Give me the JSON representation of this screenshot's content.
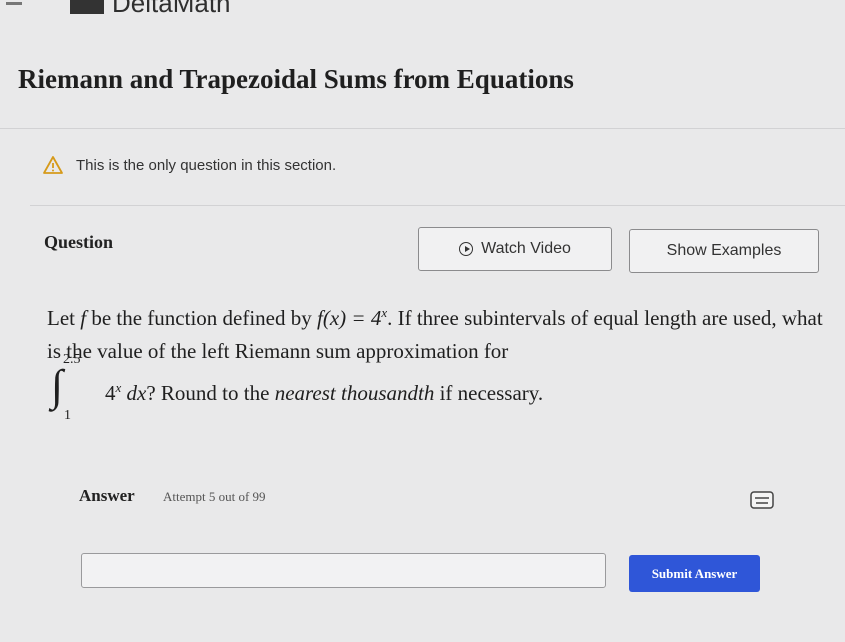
{
  "brand": {
    "name": "DeltaMath"
  },
  "page": {
    "title": "Riemann and Trapezoidal Sums from Equations"
  },
  "notice": {
    "text": "This is the only question in this section.",
    "icon": "warning-triangle-icon"
  },
  "question": {
    "label": "Question",
    "buttons": {
      "watch_video": "Watch Video",
      "show_examples": "Show Examples"
    },
    "line1_prefix": "Let ",
    "line1_f": "f",
    "line1_mid": " be the function defined by ",
    "line1_eq": "f(x) = 4",
    "line1_exp": "x",
    "line1_suffix": ". If three subintervals of equal length are used, what is the value of the left Riemann sum approximation for",
    "integral": {
      "upper": "2.5",
      "lower": "1",
      "integrand": "4",
      "exp": "x",
      "dx": " dx",
      "after": "? Round to the ",
      "emph": "nearest thousandth",
      "end": " if necessary."
    }
  },
  "answer": {
    "label": "Answer",
    "attempt": "Attempt 5 out of 99",
    "input_value": "",
    "submit_label": "Submit Answer"
  },
  "colors": {
    "background": "#e9e9ea",
    "submit": "#2f56d8",
    "warning": "#d69a1a"
  }
}
